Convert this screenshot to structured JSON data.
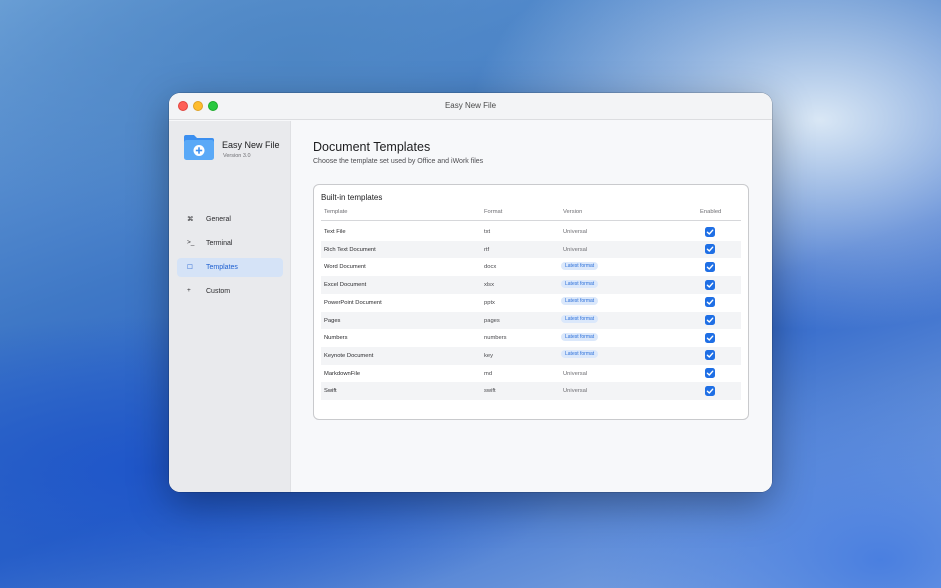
{
  "window": {
    "title": "Easy New File"
  },
  "sidebar": {
    "app_name": "Easy New File",
    "app_version": "Version 3.0",
    "items": [
      {
        "icon": "⌘",
        "label": "General"
      },
      {
        "icon": ">_",
        "label": "Terminal"
      },
      {
        "icon": "☐",
        "label": "Templates"
      },
      {
        "icon": "+",
        "label": "Custom"
      }
    ]
  },
  "main": {
    "title": "Document Templates",
    "subtitle": "Choose the template set used by Office and iWork files",
    "card": {
      "title": "Built-in templates",
      "columns": [
        "Template",
        "Format",
        "Version",
        "Enabled"
      ],
      "rows": [
        {
          "name": "Text File",
          "format": "txt",
          "version": "Universal",
          "enabled": true
        },
        {
          "name": "Rich Text Document",
          "format": "rtf",
          "version": "Universal",
          "enabled": true
        },
        {
          "name": "Word Document",
          "format": "docx",
          "version": "Latest format",
          "enabled": true
        },
        {
          "name": "Excel Document",
          "format": "xlsx",
          "version": "Latest format",
          "enabled": true
        },
        {
          "name": "PowerPoint Document",
          "format": "pptx",
          "version": "Latest format",
          "enabled": true
        },
        {
          "name": "Pages",
          "format": "pages",
          "version": "Latest format",
          "enabled": true
        },
        {
          "name": "Numbers",
          "format": "numbers",
          "version": "Latest format",
          "enabled": true
        },
        {
          "name": "Keynote Document",
          "format": "key",
          "version": "Latest format",
          "enabled": true
        },
        {
          "name": "MarkdownFile",
          "format": "md",
          "version": "Universal",
          "enabled": true
        },
        {
          "name": "Swift",
          "format": "swift",
          "version": "Universal",
          "enabled": true
        }
      ]
    }
  },
  "colors": {
    "accent": "#1f6fe5",
    "selected_bg": "#d5e3f7",
    "badge_bg": "#dbe8fb"
  }
}
